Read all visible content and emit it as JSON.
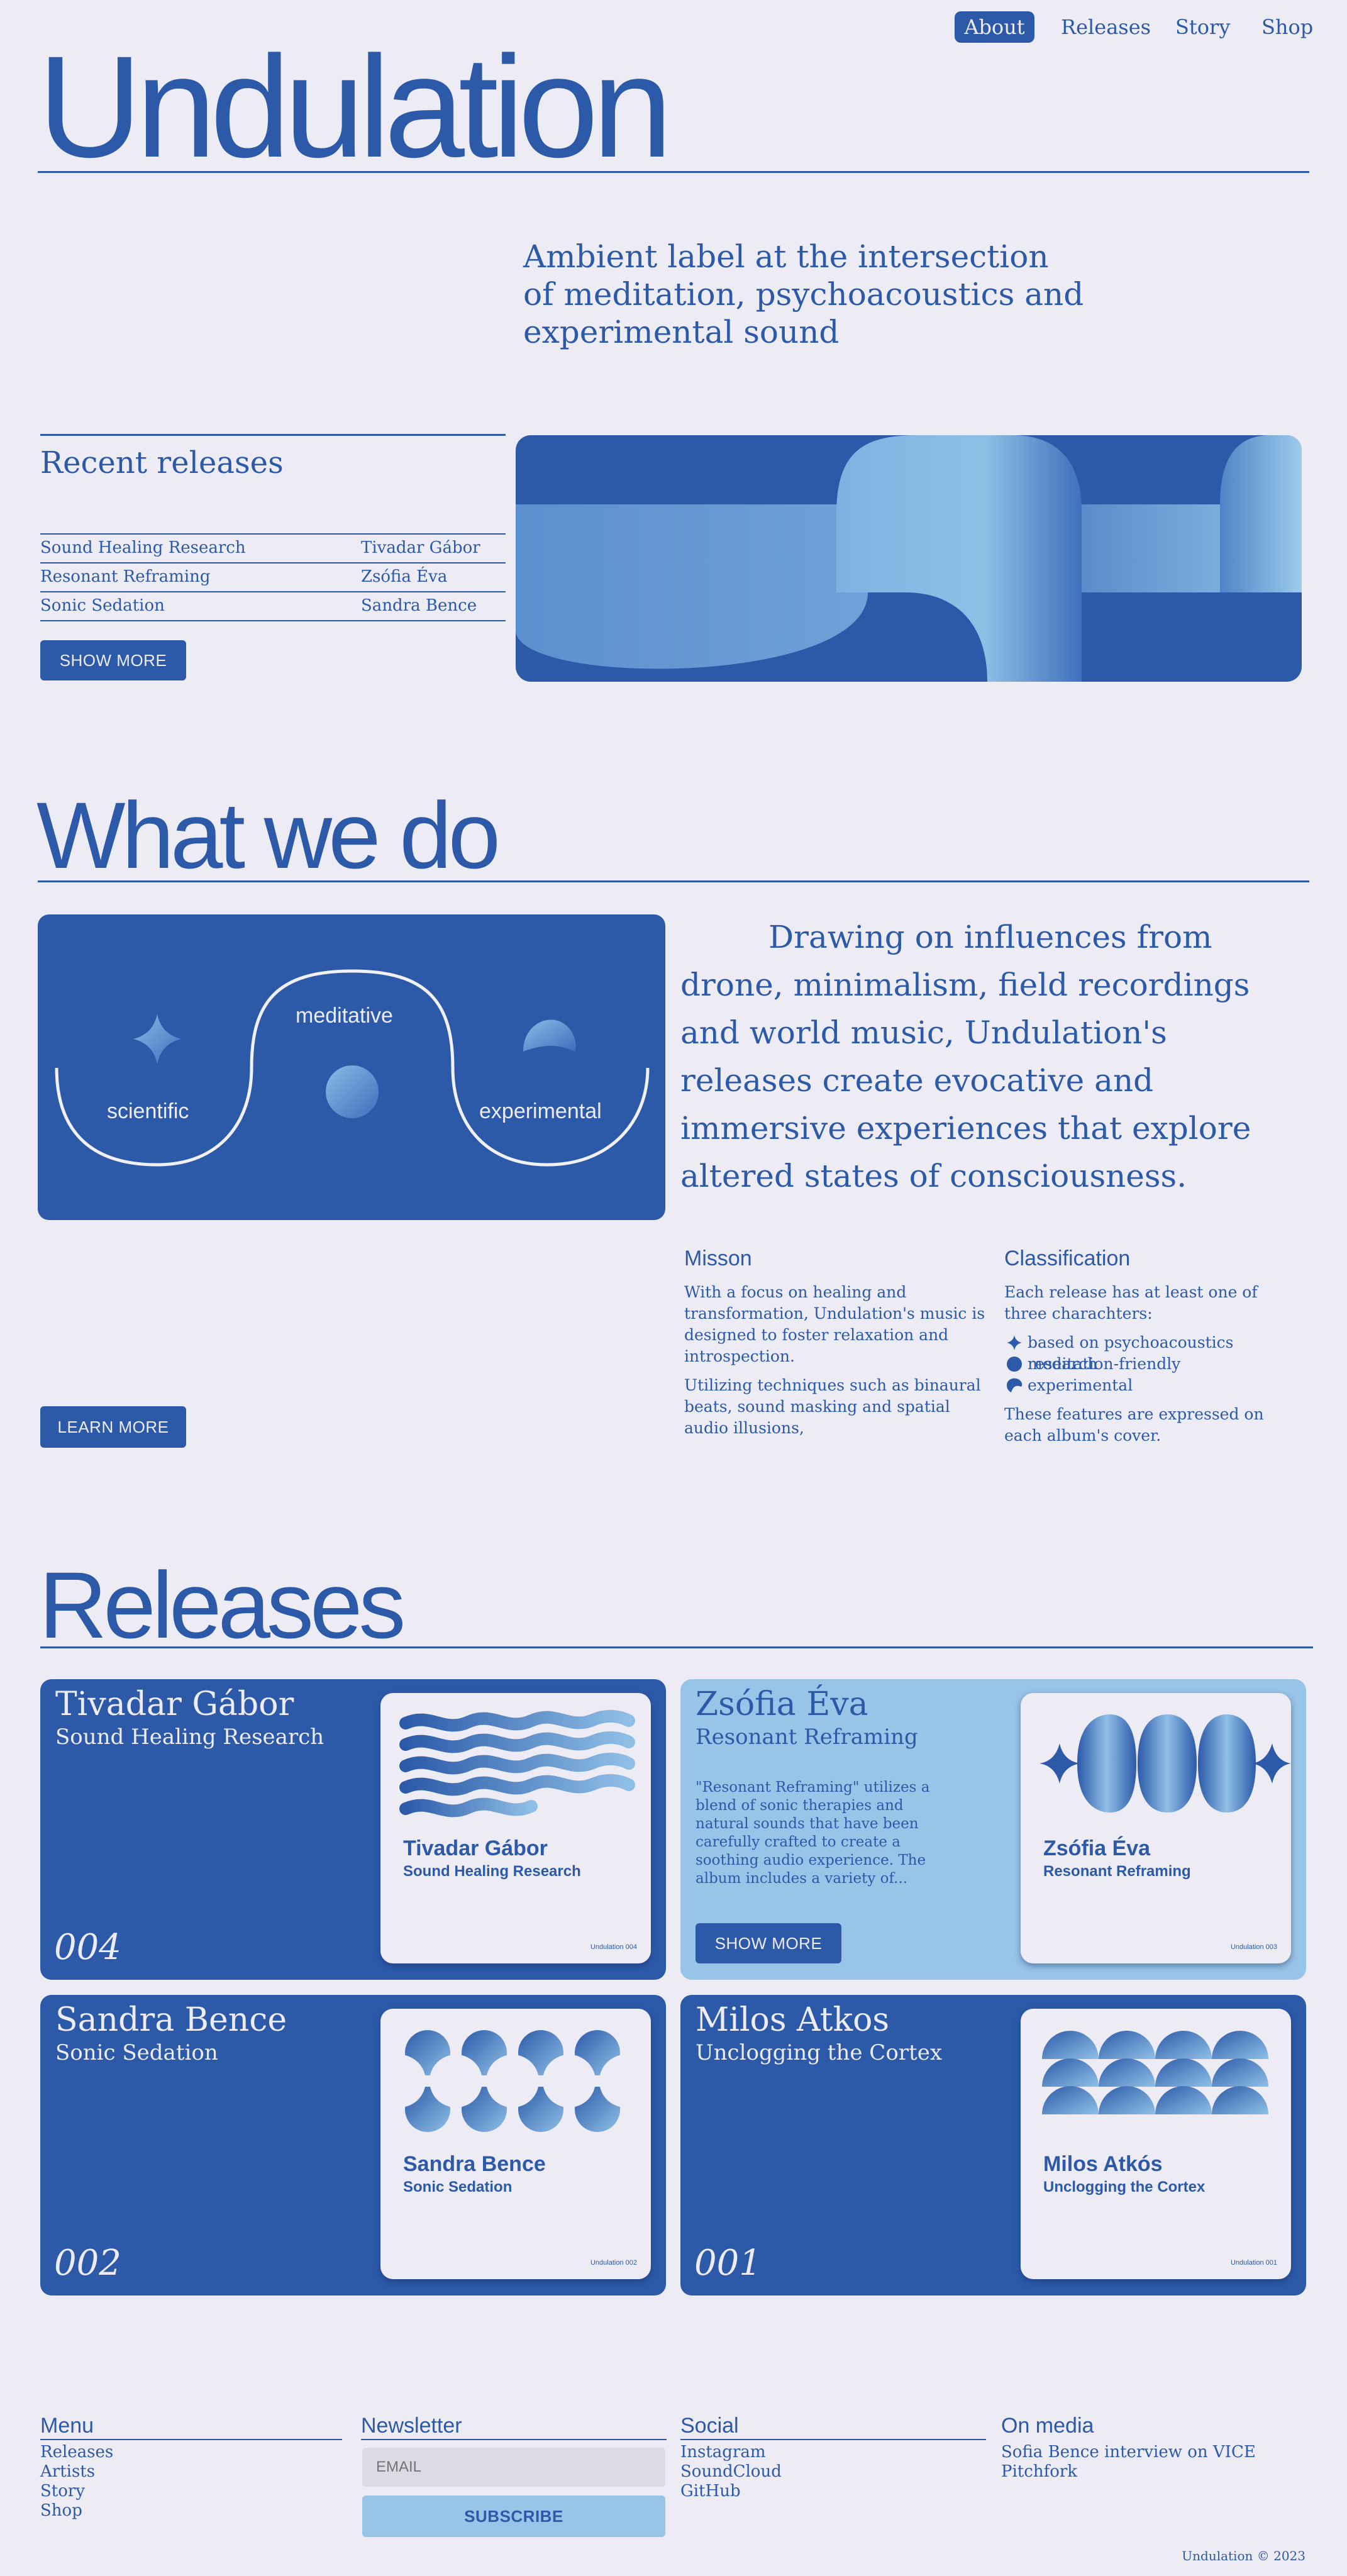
{
  "nav": {
    "items": [
      {
        "label": "About",
        "active": true
      },
      {
        "label": "Releases",
        "active": false
      },
      {
        "label": "Story",
        "active": false
      },
      {
        "label": "Shop",
        "active": false
      }
    ]
  },
  "hero": {
    "title": "Undulation",
    "tagline": "Ambient label at the intersection of meditation,  psychoacoustics and experimental sound"
  },
  "recent": {
    "heading": "Recent releases",
    "rows": [
      {
        "title": "Sound Healing Research",
        "artist": "Tivadar Gábor"
      },
      {
        "title": "Resonant Reframing",
        "artist": "Zsófia Éva"
      },
      {
        "title": "Sonic Sedation",
        "artist": "Sandra Bence"
      }
    ],
    "button": "SHOW MORE"
  },
  "what": {
    "heading": "What we do",
    "diagram": {
      "left": "scientific",
      "middle": "meditative",
      "right": "experimental"
    },
    "lead": "Drawing on influences from drone, minimalism, field recordings and world music, Undulation's releases create evocative and immersive experiences that explore altered states of consciousness.",
    "button": "LEARN MORE",
    "mission": {
      "heading": "Misson",
      "p1": " With a focus on healing and transformation, Undulation's music is designed to foster relaxation and introspection.",
      "p2": "Utilizing techniques such as binaural beats, sound masking and spatial audio illusions,"
    },
    "classification": {
      "heading": "Classification",
      "intro": "Each release has at least one of three charachters:",
      "items": [
        {
          "icon": "sparkle-icon",
          "label": "based on  psychoacoustics research"
        },
        {
          "icon": "circle-icon",
          "label": "meditation-friendly"
        },
        {
          "icon": "half-moon-icon",
          "label": "experimental"
        }
      ],
      "outro": "These features are expressed on each album's cover."
    }
  },
  "releases": {
    "heading": "Releases",
    "cards": [
      {
        "artist": "Tivadar Gábor",
        "title": "Sound Healing Research",
        "number": "004",
        "cover_artist": "Tivadar Gábor",
        "cover_title": "Sound Healing Research",
        "catalog": "Undulation 004"
      },
      {
        "artist": "Zsófia Éva",
        "title": "Resonant Reframing",
        "description": "\"Resonant Reframing\" utilizes a blend of sonic therapies and natural sounds that have been carefully crafted to create a soothing audio experience. The album includes a variety of...",
        "button": "SHOW MORE",
        "cover_artist": "Zsófia Éva",
        "cover_title": "Resonant Reframing",
        "catalog": "Undulation 003"
      },
      {
        "artist": "Sandra Bence",
        "title": "Sonic Sedation",
        "number": "002",
        "cover_artist": "Sandra Bence",
        "cover_title": "Sonic Sedation",
        "catalog": "Undulation 002"
      },
      {
        "artist": "Milos Atkos",
        "title": "Unclogging the Cortex",
        "number": "001",
        "cover_artist": "Milos Atkós",
        "cover_title": "Unclogging the Cortex",
        "catalog": "Undulation 001"
      }
    ]
  },
  "footer": {
    "menu": {
      "heading": "Menu",
      "links": [
        "Releases",
        "Artists",
        "Story",
        "Shop"
      ]
    },
    "newsletter": {
      "heading": "Newsletter",
      "placeholder": "EMAIL",
      "button": "SUBSCRIBE"
    },
    "social": {
      "heading": "Social",
      "links": [
        "Instagram",
        "SoundCloud",
        "GitHub"
      ]
    },
    "media": {
      "heading": "On media",
      "links": [
        "Sofia Bence interview on VICE",
        "Pitchfork"
      ]
    },
    "copyright": "Undulation © 2023"
  },
  "colors": {
    "background": "#edebf4",
    "primary": "#2c5aa9",
    "light": "#97c4e7"
  }
}
